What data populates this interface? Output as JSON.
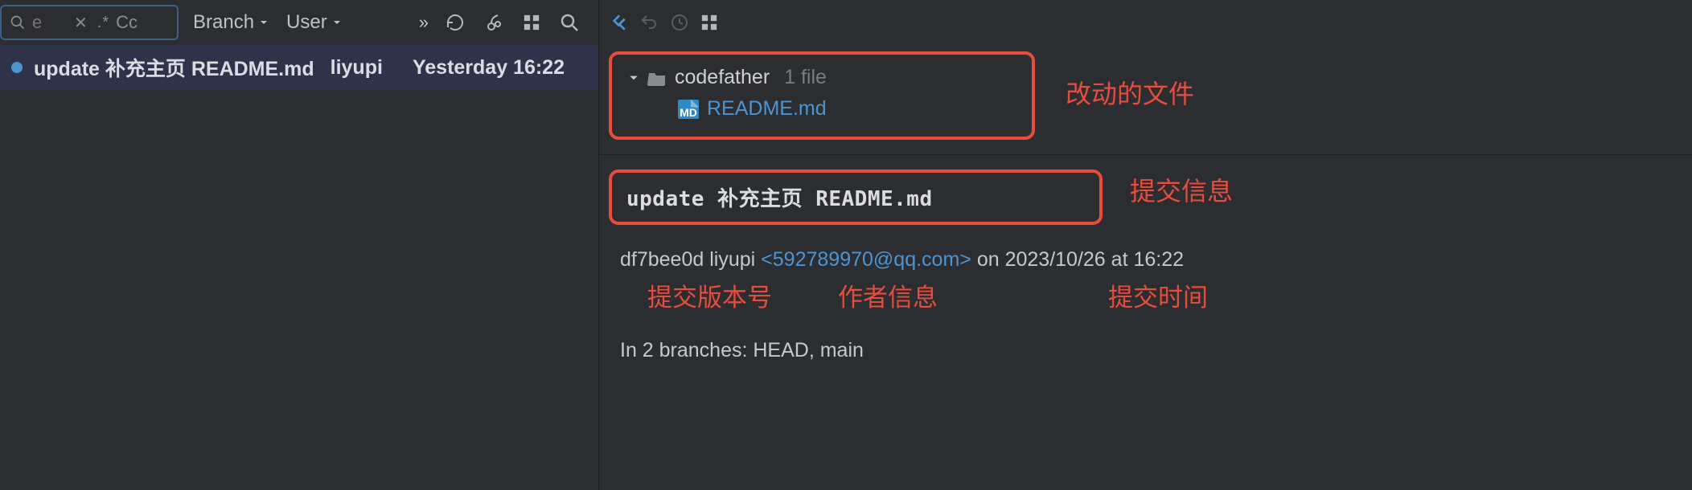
{
  "toolbar": {
    "search_placeholder": "e",
    "regex_hint": ".*",
    "case_hint": "Cc",
    "branch_label": "Branch",
    "user_label": "User",
    "expand": "»"
  },
  "commit_list": {
    "message": "update 补充主页 README.md",
    "author": "liyupi",
    "date": "Yesterday 16:22"
  },
  "file_tree": {
    "folder": "codefather",
    "file_count": "1 file",
    "file": "README.md",
    "file_badge": "MD"
  },
  "commit_detail": {
    "message": "update 补充主页 README.md",
    "hash": "df7bee0d",
    "author": "liyupi",
    "email": "<592789970@qq.com>",
    "on": "on",
    "timestamp": "2023/10/26 at 16:22",
    "branches": "In 2 branches: HEAD, main"
  },
  "annotations": {
    "files": "改动的文件",
    "commit_info": "提交信息",
    "hash": "提交版本号",
    "author_info": "作者信息",
    "timestamp": "提交时间"
  }
}
